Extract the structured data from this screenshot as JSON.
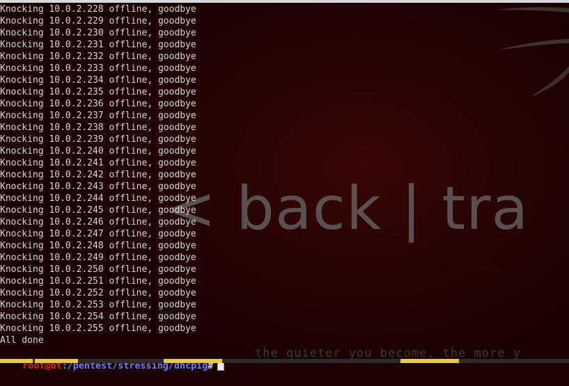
{
  "terminal": {
    "lines": [
      "Knocking 10.0.2.228 offline, goodbye",
      "Knocking 10.0.2.229 offline, goodbye",
      "Knocking 10.0.2.230 offline, goodbye",
      "Knocking 10.0.2.231 offline, goodbye",
      "Knocking 10.0.2.232 offline, goodbye",
      "Knocking 10.0.2.233 offline, goodbye",
      "Knocking 10.0.2.234 offline, goodbye",
      "Knocking 10.0.2.235 offline, goodbye",
      "Knocking 10.0.2.236 offline, goodbye",
      "Knocking 10.0.2.237 offline, goodbye",
      "Knocking 10.0.2.238 offline, goodbye",
      "Knocking 10.0.2.239 offline, goodbye",
      "Knocking 10.0.2.240 offline, goodbye",
      "Knocking 10.0.2.241 offline, goodbye",
      "Knocking 10.0.2.242 offline, goodbye",
      "Knocking 10.0.2.243 offline, goodbye",
      "Knocking 10.0.2.244 offline, goodbye",
      "Knocking 10.0.2.245 offline, goodbye",
      "Knocking 10.0.2.246 offline, goodbye",
      "Knocking 10.0.2.247 offline, goodbye",
      "Knocking 10.0.2.248 offline, goodbye",
      "Knocking 10.0.2.249 offline, goodbye",
      "Knocking 10.0.2.250 offline, goodbye",
      "Knocking 10.0.2.251 offline, goodbye",
      "Knocking 10.0.2.252 offline, goodbye",
      "Knocking 10.0.2.253 offline, goodbye",
      "Knocking 10.0.2.254 offline, goodbye",
      "Knocking 10.0.2.255 offline, goodbye",
      "All done"
    ],
    "prompt": {
      "user_host": "root@bt",
      "path": ":/pentest/stressing/dhcpig",
      "symbol": "#"
    }
  },
  "wallpaper": {
    "logo_text": "< back | tra",
    "motto_text": "the quieter you become, the more y"
  },
  "colors": {
    "terminal_text": "#d8d8d8",
    "prompt_user": "#e0241c",
    "prompt_path": "#6e7dff",
    "background": "#1c0303",
    "taskbar_accents": [
      "#e6c84a",
      "#e6c84a",
      "#e6c84a",
      "#e6c84a"
    ]
  }
}
